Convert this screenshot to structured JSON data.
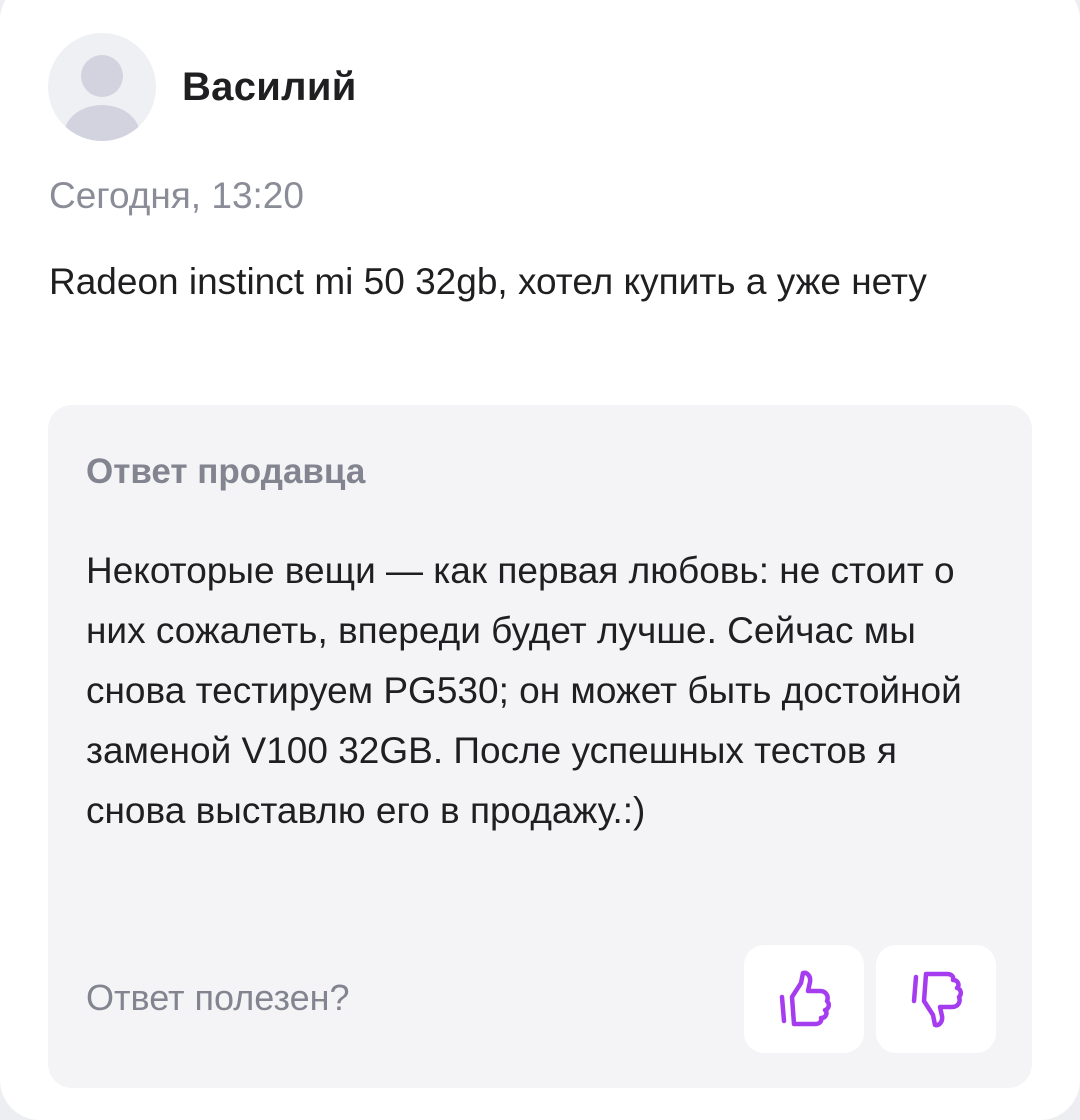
{
  "review": {
    "author": "Василий",
    "date": "Сегодня, 13:20",
    "text": "Radeon instinct mi 50 32gb, хотел купить а уже нету"
  },
  "seller_reply": {
    "title": "Ответ продавца",
    "text": "Некоторые вещи — как первая любовь: не стоит о них сожалеть, впереди будет лучше. Сейчас мы снова тестируем PG530; он может быть достойной заменой V100 32GB. После успешных тестов я снова выставлю его в продажу.:)"
  },
  "feedback": {
    "question": "Ответ полезен?",
    "like_icon": "thumbs-up-icon",
    "dislike_icon": "thumbs-down-icon"
  },
  "colors": {
    "accent": "#a63cf0",
    "muted_text": "#82848f",
    "reply_background": "#f4f4f7"
  }
}
